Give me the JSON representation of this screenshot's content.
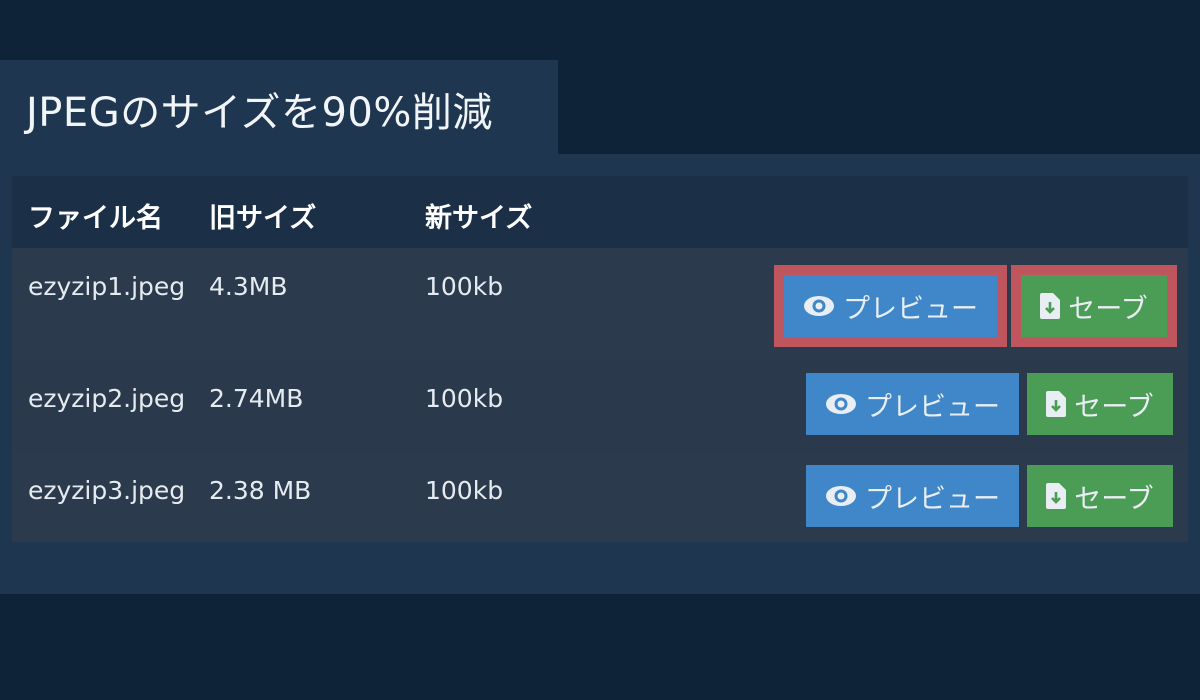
{
  "page": {
    "title": "JPEGのサイズを90%削減"
  },
  "table": {
    "headers": {
      "name": "ファイル名",
      "old_size": "旧サイズ",
      "new_size": "新サイズ"
    },
    "rows": [
      {
        "name": "ezyzip1.jpeg",
        "old_size": "4.3MB",
        "new_size": "100kb",
        "highlighted": true
      },
      {
        "name": "ezyzip2.jpeg",
        "old_size": "2.74MB",
        "new_size": "100kb",
        "highlighted": false
      },
      {
        "name": "ezyzip3.jpeg",
        "old_size": "2.38 MB",
        "new_size": "100kb",
        "highlighted": false
      }
    ],
    "actions": {
      "preview_label": "プレビュー",
      "save_label": "セーブ",
      "preview_icon": "eye-icon",
      "save_icon": "file-download-icon"
    }
  },
  "colors": {
    "background": "#0e2238",
    "panel": "#1f3650",
    "preview_button": "#3f87c9",
    "save_button": "#4b9c55",
    "highlight": "#c0565d"
  }
}
